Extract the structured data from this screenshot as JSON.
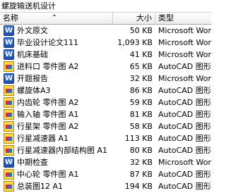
{
  "window": {
    "title": "螺旋输送机设计"
  },
  "columns": {
    "name": "名称",
    "size": "大小",
    "type": "类型"
  },
  "rows": [
    {
      "name": "外文原文",
      "size": "50 KB",
      "type": "Microsoft Word",
      "icon": "word-doc-icon"
    },
    {
      "name": "毕业设计论文111",
      "size": "1,093 KB",
      "type": "Microsoft Word",
      "icon": "word-doc-icon"
    },
    {
      "name": "机床基础",
      "size": "41 KB",
      "type": "Microsoft Word",
      "icon": "word-doc-icon"
    },
    {
      "name": "进料口 零件图 A2",
      "size": "65 KB",
      "type": "AutoCAD 图形",
      "icon": "autocad-drawing-icon"
    },
    {
      "name": "开题报告",
      "size": "32 KB",
      "type": "Microsoft Word",
      "icon": "word-doc-icon"
    },
    {
      "name": "螺旋体A3",
      "size": "86 KB",
      "type": "AutoCAD 图形",
      "icon": "autocad-drawing-icon"
    },
    {
      "name": "内齿轮 零件图 A2",
      "size": "59 KB",
      "type": "AutoCAD 图形",
      "icon": "autocad-drawing-icon"
    },
    {
      "name": "输入轴 零件图 A1",
      "size": "81 KB",
      "type": "AutoCAD 图形",
      "icon": "autocad-drawing-icon"
    },
    {
      "name": "行星架 零件图 A2",
      "size": "58 KB",
      "type": "AutoCAD 图形",
      "icon": "autocad-drawing-icon"
    },
    {
      "name": "行星减速器 A1",
      "size": "113 KB",
      "type": "AutoCAD 图形",
      "icon": "autocad-drawing-icon"
    },
    {
      "name": "行星减速器内部结构图 A1",
      "size": "80 KB",
      "type": "AutoCAD 图形",
      "icon": "autocad-drawing-icon"
    },
    {
      "name": "中期检查",
      "size": "32 KB",
      "type": "Microsoft Word",
      "icon": "word-doc-icon"
    },
    {
      "name": "中心轮 零件图 A1",
      "size": "87 KB",
      "type": "AutoCAD 图形",
      "icon": "autocad-drawing-icon"
    },
    {
      "name": "总装图12 A1",
      "size": "194 KB",
      "type": "AutoCAD 图形",
      "icon": "autocad-drawing-icon"
    }
  ]
}
